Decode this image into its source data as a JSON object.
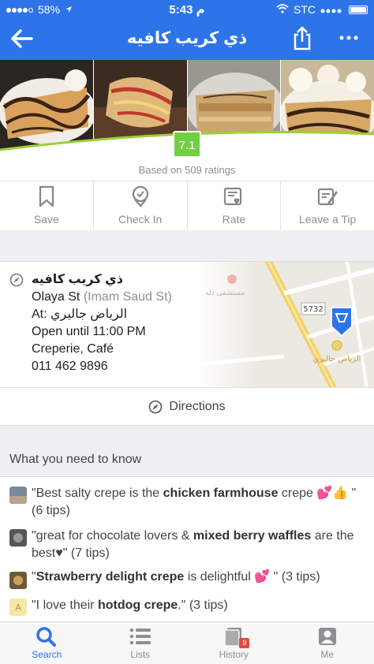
{
  "status_bar": {
    "battery_left": "58%",
    "battery_left_level": 0.58,
    "time": "5:43 م",
    "carrier": "STC"
  },
  "nav": {
    "title": "ذي كريب كافيه"
  },
  "venue": {
    "score": "7.1",
    "ratings_text": "Based on 509 ratings",
    "name": "ذي كريب كافيه",
    "street": "Olaya St",
    "cross_street": "(Imam Saud St)",
    "at": "At: الرياض جاليري",
    "hours": "Open until 11:00 PM",
    "categories": "Creperie, Café",
    "phone": "011 462 9896"
  },
  "actions": {
    "save": "Save",
    "check_in": "Check In",
    "rate": "Rate",
    "tip": "Leave a Tip"
  },
  "map": {
    "road_number": "5732",
    "place_label": "الرياض جاليري",
    "other_label": "مستشفى دله"
  },
  "directions_label": "Directions",
  "section_title": "What you need to know",
  "tips": [
    {
      "pre": "\"Best salty crepe is the ",
      "bold": "chicken farmhouse",
      "post": " crepe 💕👍 \" (6 tips)"
    },
    {
      "pre": "\"great for chocolate lovers & ",
      "bold": "mixed berry waffles",
      "post": " are the best♥\" (7 tips)"
    },
    {
      "pre": "\"",
      "bold": "Strawberry delight crepe",
      "post": " is delightful 💕 \" (3 tips)"
    },
    {
      "pre": "\"I love their ",
      "bold": "hotdog crepe",
      "post": ".\" (3 tips)"
    }
  ],
  "tabs": {
    "search": "Search",
    "lists": "Lists",
    "history": "History",
    "history_badge": "9",
    "me": "Me"
  },
  "colors": {
    "brand_blue": "#2d74e8",
    "score_green": "#73cf42"
  }
}
